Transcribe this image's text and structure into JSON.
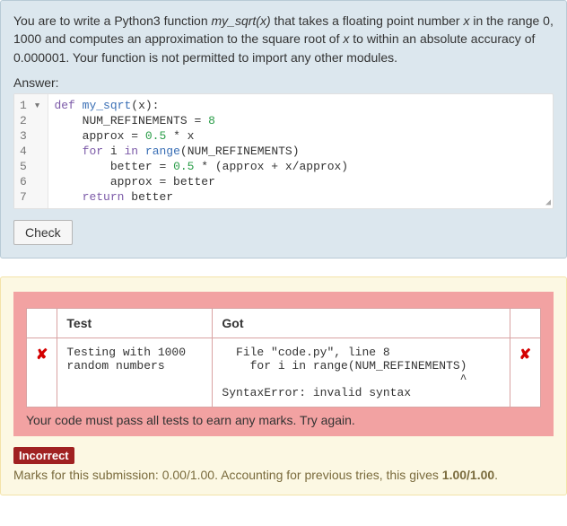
{
  "question": {
    "prompt_html": "You are to write a Python3 function <em>my_sqrt(x)</em> that takes a floating point number <em>x</em> in the range 0, 1000 and computes an approximation to the square root of <em>x</em> to within an absolute accuracy of 0.000001. Your function is not permitted to import any other modules.",
    "answer_label": "Answer:"
  },
  "editor": {
    "lines": [
      {
        "n": "1",
        "fold": "▾",
        "html": "<span class='kw'>def</span> <span class='fn'>my_sqrt</span>(x):"
      },
      {
        "n": "2",
        "fold": " ",
        "html": "    NUM_REFINEMENTS = <span class='num'>8</span>"
      },
      {
        "n": "3",
        "fold": " ",
        "html": "    approx = <span class='num'>0.5</span> * x"
      },
      {
        "n": "4",
        "fold": " ",
        "html": "    <span class='kw'>for</span> i <span class='kw'>in</span> <span class='fn'>range</span>(NUM_REFINEMENTS)"
      },
      {
        "n": "5",
        "fold": " ",
        "html": "        better = <span class='num'>0.5</span> * (approx + x/approx)"
      },
      {
        "n": "6",
        "fold": " ",
        "html": "        approx = better"
      },
      {
        "n": "7",
        "fold": " ",
        "html": "    <span class='kw'>return</span> better"
      }
    ]
  },
  "check_label": "Check",
  "results": {
    "headers": {
      "test": "Test",
      "got": "Got"
    },
    "row": {
      "icon_left": "✘",
      "test_text": "Testing with 1000\nrandom numbers",
      "got_text": "  File \"code.py\", line 8\n    for i in range(NUM_REFINEMENTS)\n                                  ^\nSyntaxError: invalid syntax",
      "icon_right": "✘"
    },
    "must_pass": "Your code must pass all tests to earn any marks. Try again."
  },
  "grade": {
    "badge": "Incorrect",
    "marks_html": "Marks for this submission: 0.00/1.00. Accounting for previous tries, this gives <strong>1.00/1.00</strong>."
  }
}
